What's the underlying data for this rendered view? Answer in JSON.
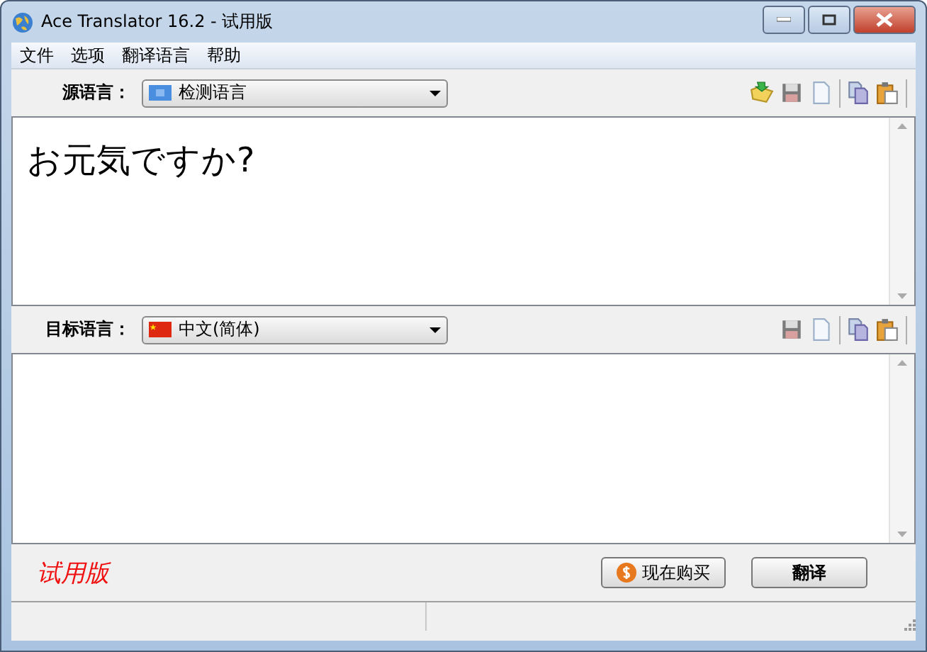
{
  "window": {
    "title": "Ace Translator 16.2 - 试用版"
  },
  "menu": [
    "文件",
    "选项",
    "翻译语言",
    "帮助"
  ],
  "source": {
    "label": "源语言：",
    "language": "检测语言",
    "flag": {
      "kind": "generic"
    },
    "text": "お元気ですか?",
    "tools": [
      {
        "kind": "open"
      },
      {
        "kind": "save"
      },
      {
        "kind": "new"
      },
      {
        "kind": "copy"
      },
      {
        "kind": "paste"
      }
    ]
  },
  "target": {
    "label": "目标语言：",
    "language": "中文(简体)",
    "flag": {
      "kind": "cn"
    },
    "tools": [
      {
        "kind": "save"
      },
      {
        "kind": "new"
      },
      {
        "kind": "copy"
      },
      {
        "kind": "paste"
      }
    ]
  },
  "trial_label": "试用版",
  "buttons": [
    {
      "label": "现在购买",
      "kind": "buy"
    },
    {
      "label": "翻译",
      "kind": "translate"
    }
  ]
}
